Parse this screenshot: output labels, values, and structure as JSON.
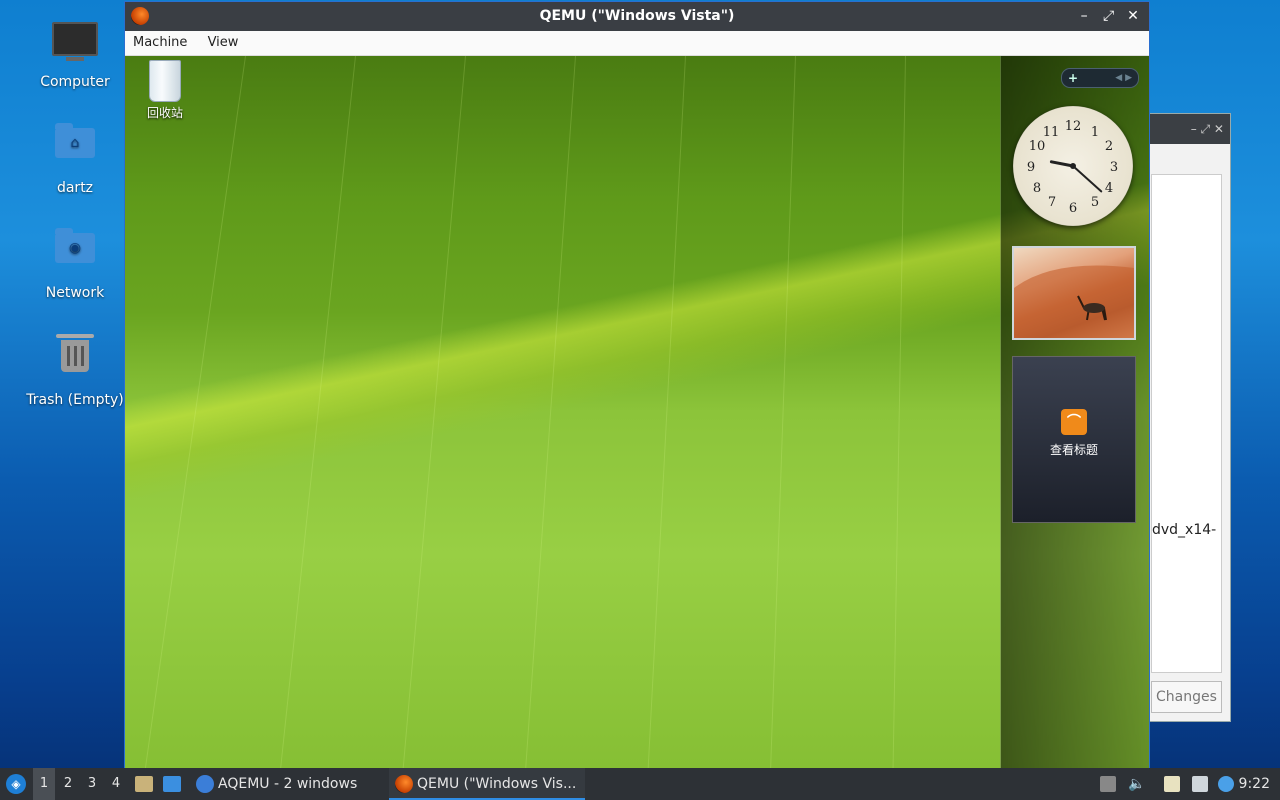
{
  "host_desktop": {
    "icons": [
      {
        "label": "Computer"
      },
      {
        "label": "dartz"
      },
      {
        "label": "Network"
      },
      {
        "label": "Trash (Empty)"
      }
    ]
  },
  "background_window": {
    "partial_text": "dvd_x14-",
    "button_label": "Changes"
  },
  "qemu_window": {
    "title": "QEMU (\"Windows Vista\")",
    "controls": {
      "minimize": "–",
      "maximize": "⤢",
      "close": "✕"
    },
    "menu": [
      "Machine",
      "View"
    ]
  },
  "guest": {
    "recycle_bin_label": "回收站",
    "sidebar": {
      "add_symbol": "+",
      "nav_arrows": "◀ ▶",
      "clock": {
        "hour": 9,
        "minute": 22
      },
      "feed_label": "查看标题",
      "feed_symbol": "⌒"
    }
  },
  "taskbar": {
    "workspaces": [
      "1",
      "2",
      "3",
      "4"
    ],
    "active_workspace": "1",
    "tasks": [
      {
        "label": "AQEMU - 2 windows",
        "active": false
      },
      {
        "label": "QEMU (\"Windows Vis...",
        "active": true
      }
    ],
    "clock": "9:22"
  },
  "colors": {
    "titlebar": "#3a3e44",
    "taskbar": "#2d3136",
    "accent": "#2f8de4"
  }
}
